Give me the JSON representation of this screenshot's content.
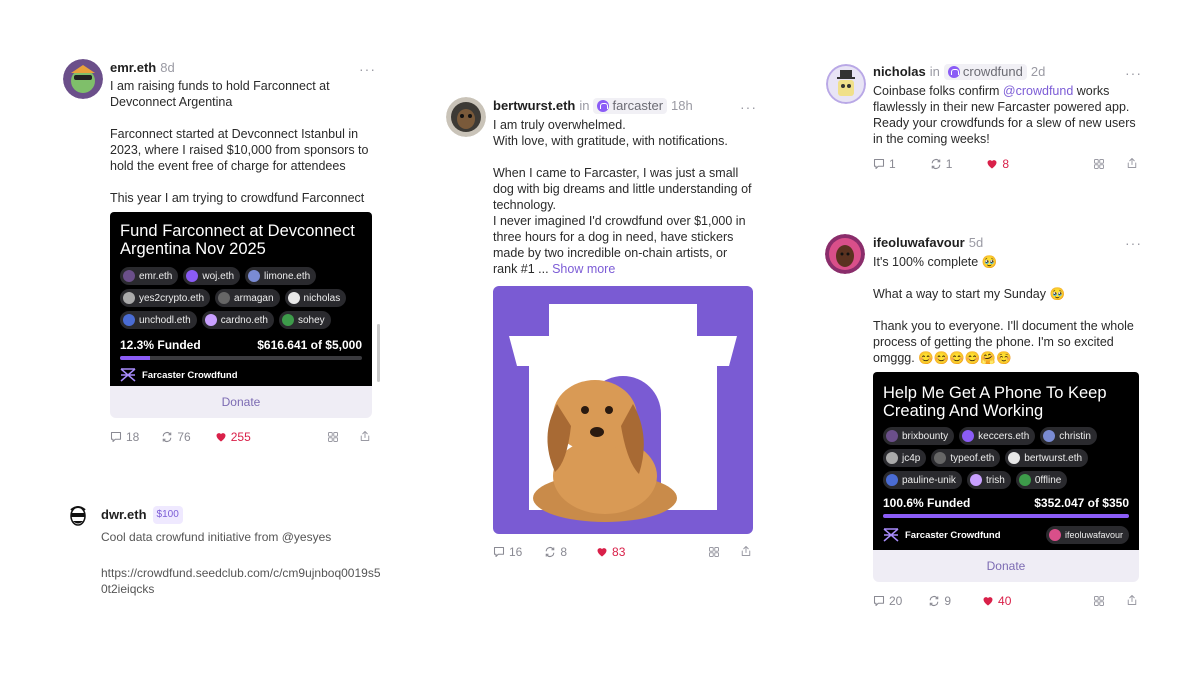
{
  "colors": {
    "accent": "#8b5cf6",
    "like": "#d92049",
    "muted": "#9a9aa3",
    "card_bg": "#000000"
  },
  "posts": {
    "emr": {
      "username": "emr.eth",
      "time": "8d",
      "text1": "I am raising funds to hold Farconnect at\nDevconnect Argentina",
      "text2": "Farconnect started at Devconnect Istanbul in\n2023, where I raised $10,000 from sponsors to\nhold the event free of charge for attendees",
      "text3": "This year I am trying to crowdfund Farconnect",
      "card": {
        "title": "Fund Farconnect at Devconnect Argentina Nov 2025",
        "contributors": [
          "emr.eth",
          "woj.eth",
          "limone.eth",
          "yes2crypto.eth",
          "armagan",
          "nicholas",
          "unchodl.eth",
          "cardno.eth",
          "sohey"
        ],
        "funded_label": "12.3% Funded",
        "amount_label": "$616.641 of $5,000",
        "progress": 0.123,
        "brand": "Farcaster Crowdfund"
      },
      "donate_label": "Donate",
      "replies": "18",
      "recasts": "76",
      "likes": "255"
    },
    "dwr": {
      "username": "dwr.eth",
      "amount": "$100",
      "text1": "Cool data crowfund initiative from @yesyes",
      "url": "https://crowdfund.seedclub.com/c/cm9ujnboq0019s5\n0t2ieiqcks"
    },
    "bertwurst": {
      "username": "bertwurst.eth",
      "in_label": "in",
      "channel": "farcaster",
      "time": "18h",
      "text1": "I am truly overwhelmed.\nWith love, with gratitude, with notifications.",
      "text2": "When I came to Farcaster, I was just a small\ndog with big dreams and little understanding of\ntechnology.\nI never imagined I'd crowdfund over $1,000 in\nthree hours for a dog in need, have stickers\nmade by two incredible on-chain artists, or\nrank #1 ...",
      "show_more": "Show more",
      "replies": "16",
      "recasts": "8",
      "likes": "83"
    },
    "nicholas": {
      "username": "nicholas",
      "in_label": "in",
      "channel": "crowdfund",
      "time": "2d",
      "text_before": "Coinbase folks confirm ",
      "mention": "@crowdfund",
      "text_after": " works\nflawlessly in their new Farcaster powered app.\nReady your crowdfunds for a slew of new users\nin the coming weeks!",
      "replies": "1",
      "recasts": "1",
      "likes": "8"
    },
    "ifeoluwa": {
      "username": "ifeoluwafavour",
      "time": "5d",
      "text1": "It's 100% complete 🥹",
      "text2": "What a way to start my Sunday 🥹",
      "text3": "Thank you to everyone. I'll document the whole\nprocess of getting the phone. I'm so excited\nomggg. 😊😊😊😊🤗☺️",
      "card": {
        "title": "Help Me Get A Phone To Keep Creating And Working",
        "contributors": [
          "brixbounty",
          "keccers.eth",
          "christin",
          "jc4p",
          "typeof.eth",
          "bertwurst.eth",
          "pauline-unik",
          "trish",
          "0ffline"
        ],
        "funded_label": "100.6% Funded",
        "amount_label": "$352.047 of $350",
        "progress": 1.0,
        "brand": "Farcaster Crowdfund",
        "owner": "ifeoluwafavour"
      },
      "donate_label": "Donate",
      "replies": "20",
      "recasts": "9",
      "likes": "40"
    }
  }
}
